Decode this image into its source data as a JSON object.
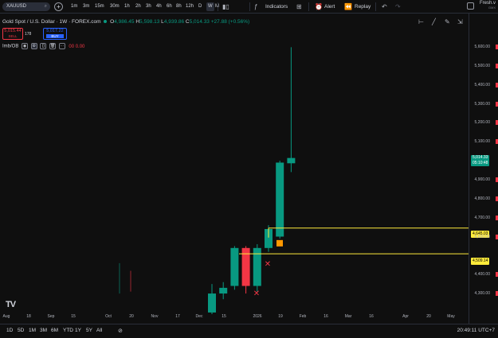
{
  "toolbar": {
    "symbol": "XAUUSD",
    "add_symbol": "+",
    "timeframes": [
      "1m",
      "3m",
      "15m",
      "30m",
      "1h",
      "2h",
      "3h",
      "4h",
      "6h",
      "8h",
      "12h",
      "D",
      "W",
      "M"
    ],
    "active_timeframe": "W",
    "indicators_label": "Indicators",
    "alert_label": "Alert",
    "replay_label": "Replay",
    "account_label": "Fresh.v",
    "account_sub": "GMX"
  },
  "legend": {
    "title": "Gold Spot / U.S. Dollar · 1W · FOREX.com",
    "o_label": "O",
    "o": "4,986.45",
    "h_label": "H",
    "h": "5,598.13",
    "l_label": "L",
    "l": "4,939.86",
    "c_label": "C",
    "c": "5,014.33",
    "change": "+27.88 (+0.56%)"
  },
  "trade": {
    "sell_price": "5,015.44",
    "sell_label": "SELL",
    "spread": "178",
    "buy_price": "5,017.22",
    "buy_label": "BUY"
  },
  "indicator": {
    "name": "Imb/OB",
    "values": "00 0.00"
  },
  "price_axis": {
    "labels": [
      "5,600.00",
      "5,500.00",
      "5,400.00",
      "5,300.00",
      "5,200.00",
      "5,100.00",
      "4,900.00",
      "4,800.00",
      "4,700.00",
      "4,600.00",
      "4,400.00",
      "4,300.00"
    ],
    "current_price": "5,014.33",
    "countdown": "05:10:48",
    "level_upper": "4,645.03",
    "level_lower": "4,509.14"
  },
  "time_axis": {
    "labels": [
      "Aug",
      "18",
      "Sep",
      "15",
      "Oct",
      "20",
      "Nov",
      "17",
      "Dec",
      "15",
      "2026",
      "19",
      "Feb",
      "16",
      "Mar",
      "16",
      "Apr",
      "20",
      "May"
    ]
  },
  "bottom": {
    "ranges": [
      "1D",
      "5D",
      "1M",
      "3M",
      "6M",
      "YTD",
      "1Y",
      "5Y",
      "All"
    ],
    "clock": "20:49:11 UTC+7"
  },
  "logo_text": "TV",
  "colors": {
    "up": "#089981",
    "down": "#f23645",
    "level": "#ffeb3b",
    "background": "#0f0f0f"
  },
  "chart_data": {
    "type": "candlestick",
    "timeframe": "1W",
    "candles": [
      {
        "t": "2025-12-08",
        "o": 4200,
        "h": 4350,
        "l": 4180,
        "c": 4300
      },
      {
        "t": "2025-12-15",
        "o": 4300,
        "h": 4360,
        "l": 4270,
        "c": 4330
      },
      {
        "t": "2025-12-22",
        "o": 4340,
        "h": 4550,
        "l": 4320,
        "c": 4540
      },
      {
        "t": "2025-12-29",
        "o": 4540,
        "h": 4550,
        "l": 4300,
        "c": 4340
      },
      {
        "t": "2026-01-05",
        "o": 4340,
        "h": 4560,
        "l": 4310,
        "c": 4540
      },
      {
        "t": "2026-01-12",
        "o": 4540,
        "h": 4660,
        "l": 4520,
        "c": 4640
      },
      {
        "t": "2026-01-19",
        "o": 4600,
        "h": 5000,
        "l": 4590,
        "c": 4990
      },
      {
        "t": "2026-01-26",
        "o": 4986.45,
        "h": 5598.13,
        "l": 4939.86,
        "c": 5014.33
      }
    ],
    "levels": [
      4645.03,
      4509.14
    ],
    "y_range": [
      4250,
      5650
    ]
  }
}
